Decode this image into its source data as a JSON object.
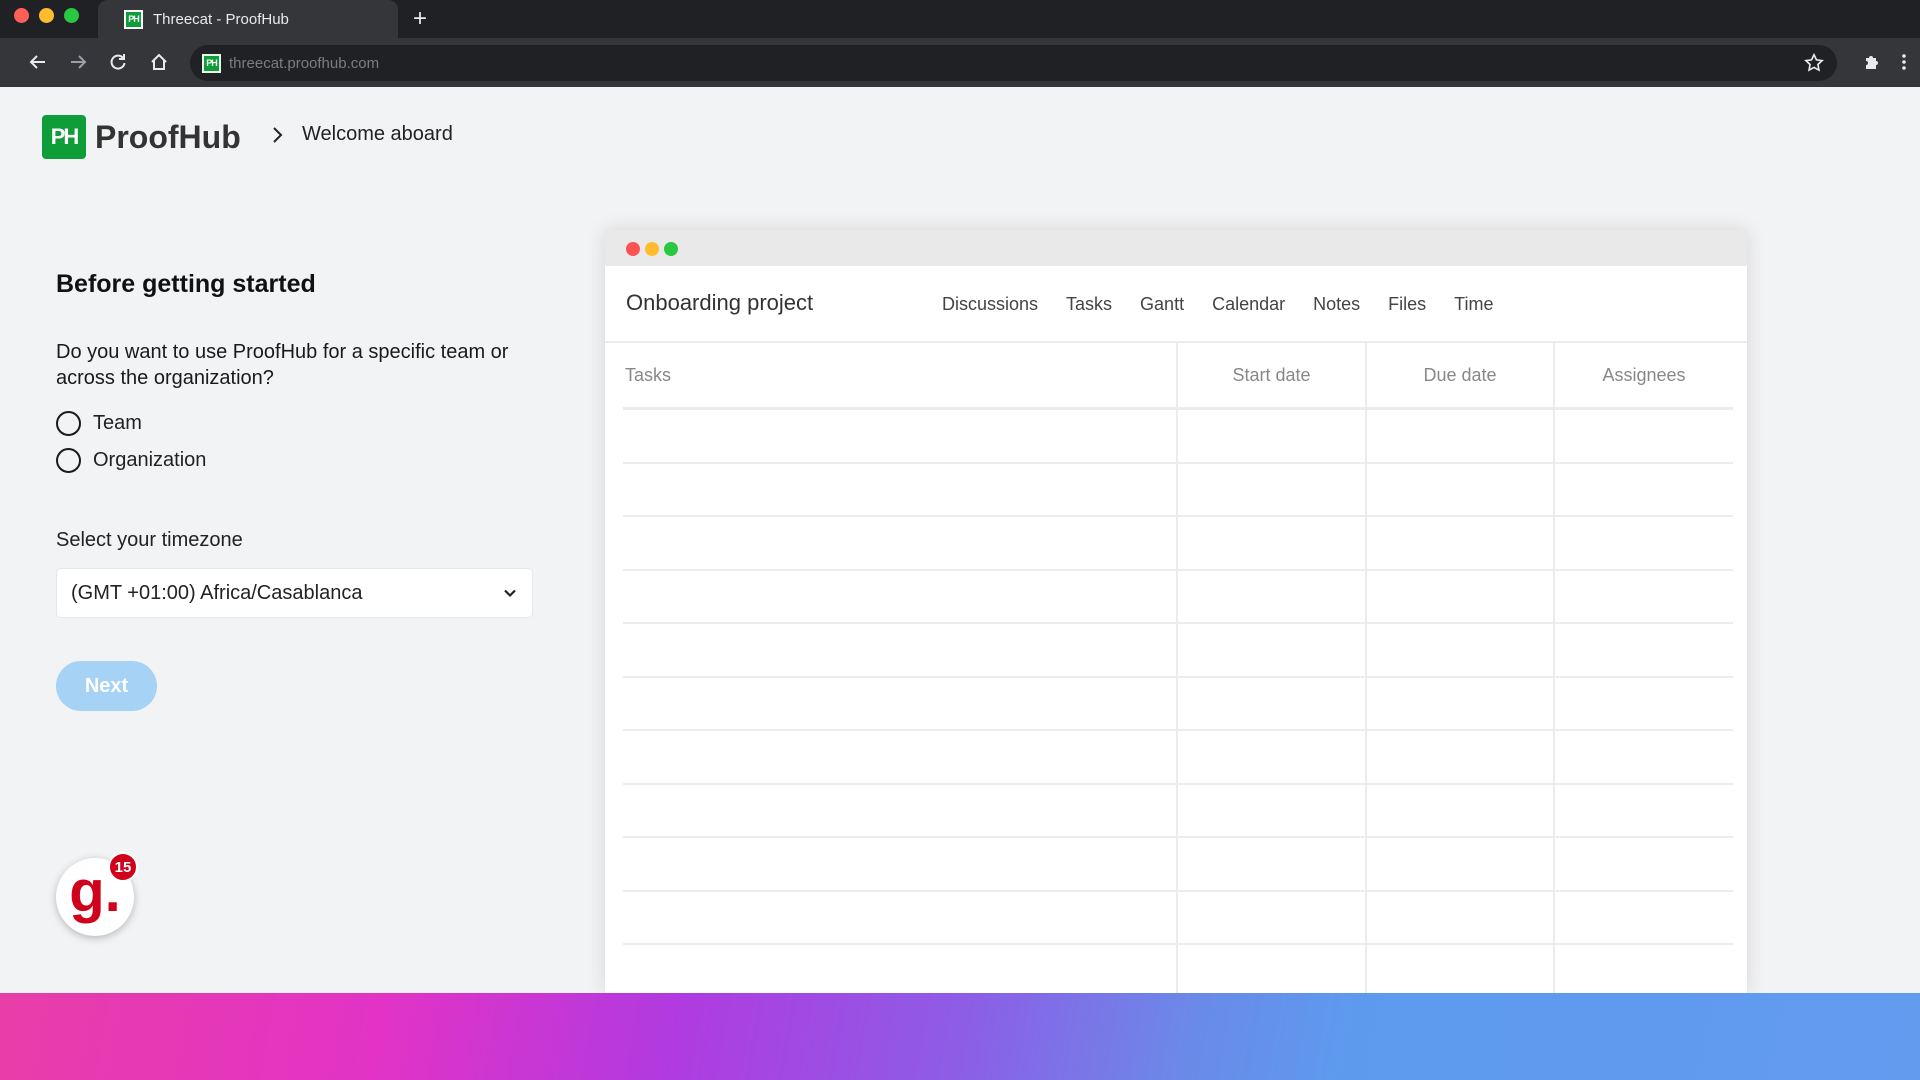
{
  "browser": {
    "tab_title": "Threecat - ProofHub",
    "url": "threecat.proofhub.com",
    "favicon_text": "PH",
    "new_tab_label": "+"
  },
  "header": {
    "logo_mark": "PH",
    "logo_text": "ProofHub",
    "breadcrumb": "Welcome aboard"
  },
  "form": {
    "title": "Before getting started",
    "question": "Do you want to use ProofHub for a specific team or across the organization?",
    "options": [
      {
        "label": "Team",
        "checked": false
      },
      {
        "label": "Organization",
        "checked": false
      }
    ],
    "timezone_label": "Select your timezone",
    "timezone_value": "(GMT +01:00) Africa/Casablanca",
    "next_label": "Next",
    "next_color": "#a6d2f6"
  },
  "widget": {
    "glyph": "g.",
    "badge_count": "15"
  },
  "mock": {
    "project_title": "Onboarding project",
    "nav": [
      "Discussions",
      "Tasks",
      "Gantt",
      "Calendar",
      "Notes",
      "Files",
      "Time"
    ],
    "columns": [
      "Tasks",
      "Start date",
      "Due date",
      "Assignees"
    ],
    "row_count": 11
  },
  "colors": {
    "brand_green": "#0f9d39",
    "badge_red": "#d0021b"
  }
}
